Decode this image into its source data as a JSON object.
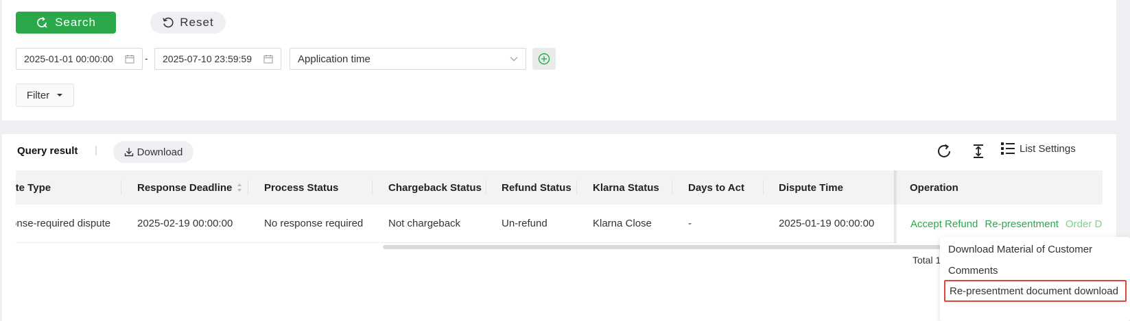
{
  "search_form": {
    "search_label": "Search",
    "reset_label": "Reset",
    "date_from": "2025-01-01 00:00:00",
    "date_to": "2025-07-10 23:59:59",
    "date_separator": "-",
    "time_type": "Application time",
    "filter_label": "Filter"
  },
  "results": {
    "title": "Query result",
    "separator": "|",
    "download_label": "Download",
    "list_settings_label": "List Settings",
    "columns": [
      "Dispute Type",
      "Response Deadline",
      "Process Status",
      "Chargeback Status",
      "Refund Status",
      "Klarna Status",
      "Days to Act",
      "Dispute Time",
      "Operation"
    ],
    "rows": [
      {
        "dispute_type": "Response-required dispute",
        "response_deadline": "2025-02-19 00:00:00",
        "process_status": "No response required",
        "chargeback_status": "Not chargeback",
        "refund_status": "Un-refund",
        "klarna_status": "Klarna Close",
        "days_to_act": "-",
        "dispute_time": "2025-01-19 00:00:00",
        "operations": [
          "Accept Refund",
          "Re-presentment",
          "Order Details"
        ]
      }
    ],
    "total_label": "Total 1"
  },
  "dropdown_menu": {
    "items": [
      "Download Material of Customer",
      "Comments",
      "Re-presentment document download"
    ]
  },
  "colors": {
    "primary": "#2ba84a",
    "highlight_border": "#e0443c",
    "page_bg": "#eef0f3"
  }
}
